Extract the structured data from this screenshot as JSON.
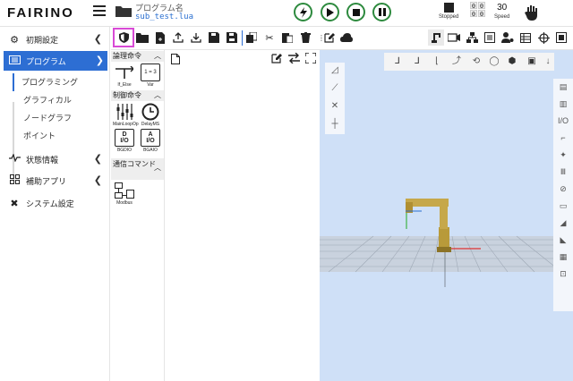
{
  "header": {
    "logo": "FAIRINO",
    "program_label": "プログラム名",
    "program_file": "sub_test.lua",
    "status_label": "Stopped",
    "counter_top": [
      "0",
      "0"
    ],
    "counter_bottom": [
      "0",
      "0"
    ],
    "speed_value": "30",
    "speed_label": "Speed"
  },
  "sidebar": {
    "items": [
      {
        "label": "初期設定",
        "icon": "gear-icon"
      },
      {
        "label": "プログラム",
        "icon": "program-icon"
      },
      {
        "label": "状態情報",
        "icon": "pulse-icon"
      },
      {
        "label": "補助アプリ",
        "icon": "grid-icon"
      },
      {
        "label": "システム設定",
        "icon": "tools-icon"
      }
    ],
    "sub_items": [
      "プログラミング",
      "グラフィカル",
      "ノードグラフ",
      "ポイント"
    ]
  },
  "palette": {
    "cat_logic": "論理命令",
    "cat_control": "制御命令",
    "cat_comm": "通信コマンド",
    "cmd_if": "If_Else",
    "cmd_var": "Var",
    "cmd_var_box": "1 = 3",
    "cmd_mainloop": "MainLoopOp",
    "cmd_delay": "DelayMS",
    "cmd_bgdio": "BGDIO",
    "cmd_bgdio_box_top": "D",
    "cmd_bgdio_box_bottom": "I/O",
    "cmd_bgaio": "BGAIO",
    "cmd_bgaio_box_top": "A",
    "cmd_bgaio_box_bottom": "I/O",
    "cmd_modbus": "Modbus"
  },
  "view3d": {
    "right_io_label": "I/O"
  },
  "colors": {
    "accent": "#2d6ed3",
    "highlight": "#d94ad6",
    "control_green": "#2d8a3e",
    "view_bg": "#cfe0f7"
  }
}
